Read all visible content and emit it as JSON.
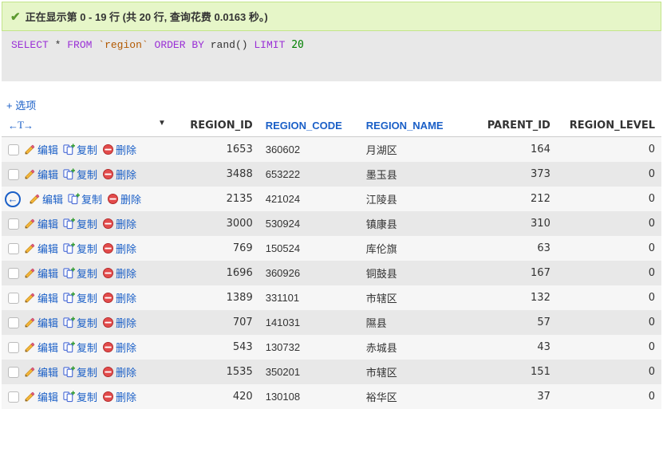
{
  "banner": {
    "text": "正在显示第 0 - 19 行 (共 20 行, 查询花费 0.0163 秒。)"
  },
  "sql": {
    "select": "SELECT",
    "star": "*",
    "from": "FROM",
    "table": "`region`",
    "orderby": "ORDER BY",
    "rand": "rand()",
    "limit": "LIMIT",
    "n": "20"
  },
  "options_label": "+ 选项",
  "sort_header": "←T→",
  "actions": {
    "edit": "编辑",
    "copy": "复制",
    "delete": "删除"
  },
  "columns": {
    "region_id": "REGION_ID",
    "region_code": "REGION_CODE",
    "region_name": "REGION_NAME",
    "parent_id": "PARENT_ID",
    "region_level": "REGION_LEVEL"
  },
  "focus_arrow": "←",
  "chart_data": {
    "type": "table",
    "columns": [
      "REGION_ID",
      "REGION_CODE",
      "REGION_NAME",
      "PARENT_ID",
      "REGION_LEVEL"
    ],
    "rows": [
      [
        1653,
        "360602",
        "月湖区",
        164,
        0
      ],
      [
        3488,
        "653222",
        "墨玉县",
        373,
        0
      ],
      [
        2135,
        "421024",
        "江陵县",
        212,
        0
      ],
      [
        3000,
        "530924",
        "镇康县",
        310,
        0
      ],
      [
        769,
        "150524",
        "库伦旗",
        63,
        0
      ],
      [
        1696,
        "360926",
        "铜鼓县",
        167,
        0
      ],
      [
        1389,
        "331101",
        "市辖区",
        132,
        0
      ],
      [
        707,
        "141031",
        "隰县",
        57,
        0
      ],
      [
        543,
        "130732",
        "赤城县",
        43,
        0
      ],
      [
        1535,
        "350201",
        "市辖区",
        151,
        0
      ],
      [
        420,
        "130108",
        "裕华区",
        37,
        0
      ]
    ]
  },
  "rows": [
    {
      "id": "1653",
      "code": "360602",
      "name": "月湖区",
      "parent": "164",
      "level": "0"
    },
    {
      "id": "3488",
      "code": "653222",
      "name": "墨玉县",
      "parent": "373",
      "level": "0"
    },
    {
      "id": "2135",
      "code": "421024",
      "name": "江陵县",
      "parent": "212",
      "level": "0"
    },
    {
      "id": "3000",
      "code": "530924",
      "name": "镇康县",
      "parent": "310",
      "level": "0"
    },
    {
      "id": "769",
      "code": "150524",
      "name": "库伦旗",
      "parent": "63",
      "level": "0"
    },
    {
      "id": "1696",
      "code": "360926",
      "name": "铜鼓县",
      "parent": "167",
      "level": "0"
    },
    {
      "id": "1389",
      "code": "331101",
      "name": "市辖区",
      "parent": "132",
      "level": "0"
    },
    {
      "id": "707",
      "code": "141031",
      "name": "隰县",
      "parent": "57",
      "level": "0"
    },
    {
      "id": "543",
      "code": "130732",
      "name": "赤城县",
      "parent": "43",
      "level": "0"
    },
    {
      "id": "1535",
      "code": "350201",
      "name": "市辖区",
      "parent": "151",
      "level": "0"
    },
    {
      "id": "420",
      "code": "130108",
      "name": "裕华区",
      "parent": "37",
      "level": "0"
    }
  ]
}
